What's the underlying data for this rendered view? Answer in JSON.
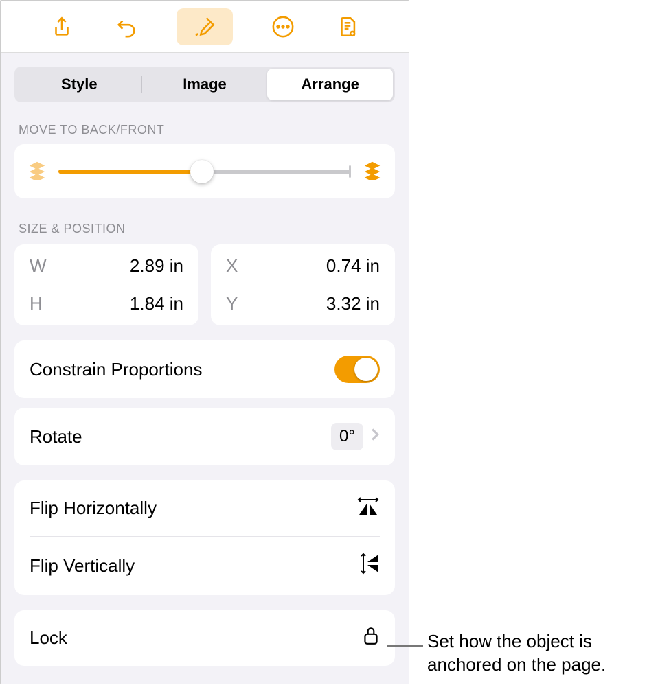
{
  "toolbar": {
    "share_icon": "share-icon",
    "undo_icon": "undo-icon",
    "format_icon": "format-brush-icon",
    "more_icon": "more-icon",
    "document_icon": "document-settings-icon"
  },
  "tabs": {
    "style": "Style",
    "image": "Image",
    "arrange": "Arrange"
  },
  "sections": {
    "move": "MOVE TO BACK/FRONT",
    "size": "SIZE & POSITION"
  },
  "sizepos": {
    "w_label": "W",
    "w_value": "2.89 in",
    "h_label": "H",
    "h_value": "1.84 in",
    "x_label": "X",
    "x_value": "0.74 in",
    "y_label": "Y",
    "y_value": "3.32 in"
  },
  "constrain": {
    "label": "Constrain Proportions",
    "on": true
  },
  "rotate": {
    "label": "Rotate",
    "value": "0°"
  },
  "flip": {
    "h": "Flip Horizontally",
    "v": "Flip Vertically"
  },
  "lock": {
    "label": "Lock"
  },
  "callout": "Set how the object is anchored on the page."
}
